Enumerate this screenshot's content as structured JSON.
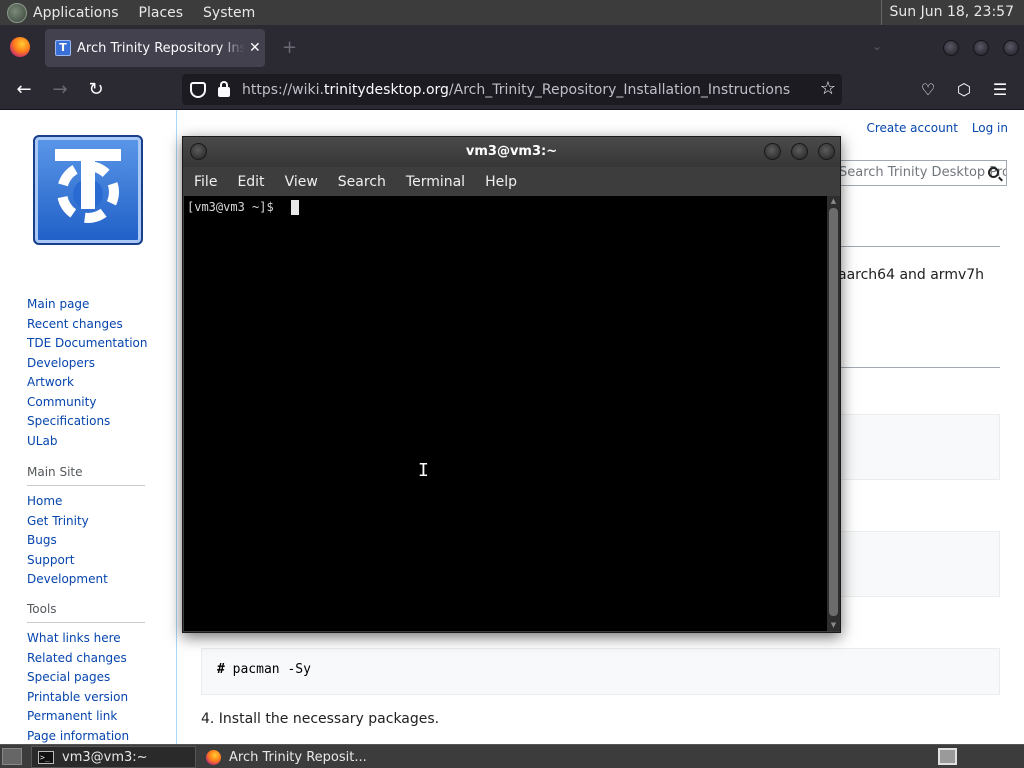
{
  "top_panel": {
    "menus": [
      "Applications",
      "Places",
      "System"
    ],
    "clock": "Sun Jun 18, 23:57"
  },
  "browser": {
    "tab": {
      "title": "Arch Trinity Repository Installation Instructions",
      "close": "✕"
    },
    "new_tab": "+",
    "list_all_tabs": "⌄",
    "url_prefix": "https://wiki.",
    "url_host": "trinitydesktop.org",
    "url_path": "/Arch_Trinity_Repository_Installation_Instructions",
    "icons": {
      "back": "←",
      "forward": "→",
      "reload": "↻",
      "star": "☆",
      "pocket": "♡",
      "extensions": "⬡",
      "menu": "☰"
    }
  },
  "wiki": {
    "personal": {
      "create_account": "Create account",
      "log_in": "Log in"
    },
    "search_placeholder": "Search Trinity Desktop Project",
    "logo_letter": "T",
    "navigation": [
      "Main page",
      "Recent changes",
      "TDE Documentation",
      "Developers",
      "Artwork",
      "Community",
      "Specifications",
      "ULab"
    ],
    "main_site": {
      "heading": "Main Site",
      "items": [
        "Home",
        "Get Trinity",
        "Bugs",
        "Support",
        "Development"
      ]
    },
    "tools": {
      "heading": "Tools",
      "items": [
        "What links here",
        "Related changes",
        "Special pages",
        "Printable version",
        "Permanent link",
        "Page information"
      ]
    },
    "content": {
      "arch_text": "aarch64 and armv7h",
      "command_hash": "#",
      "command": " pacman -Sy",
      "step4": "4. Install the necessary packages."
    }
  },
  "terminal": {
    "title": "vm3@vm3:~",
    "menus": [
      "File",
      "Edit",
      "View",
      "Search",
      "Terminal",
      "Help"
    ],
    "prompt": "[vm3@vm3 ~]$ ",
    "ibeam": "I"
  },
  "taskbar": {
    "tasks": [
      {
        "label": "vm3@vm3:~",
        "icon": ">_"
      },
      {
        "label": "Arch Trinity Reposit..."
      }
    ]
  }
}
